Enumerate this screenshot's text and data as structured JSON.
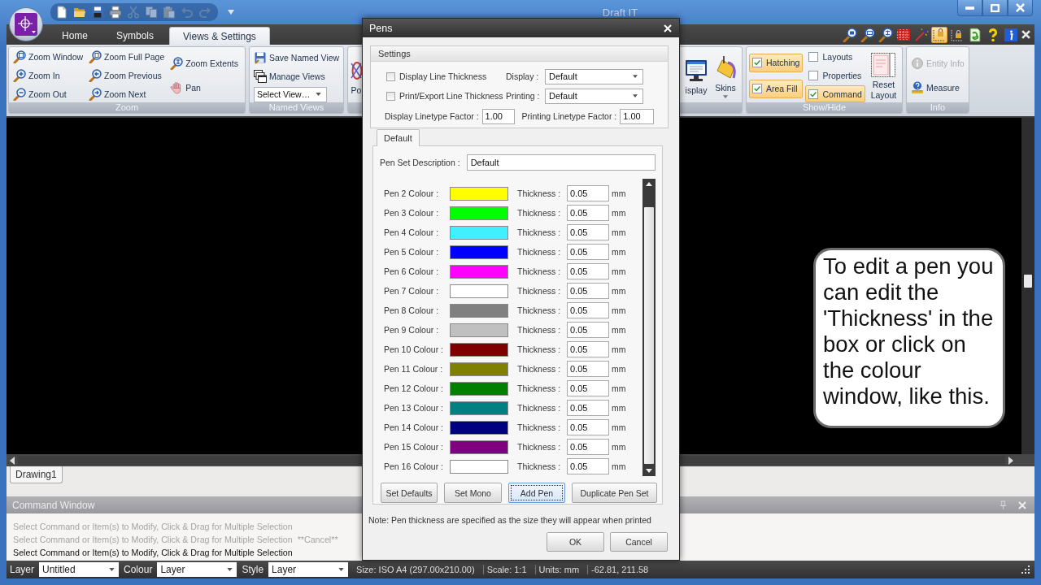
{
  "window": {
    "title": "Draft IT"
  },
  "quick_access": [
    {
      "disabled": false
    },
    {
      "disabled": false
    },
    {
      "disabled": false
    },
    {
      "disabled": false
    },
    {
      "disabled": true
    },
    {
      "disabled": true
    },
    {
      "disabled": true
    },
    {
      "disabled": true
    },
    {
      "disabled": true
    }
  ],
  "ribbon": {
    "tabs": [
      {
        "label": "Home",
        "selected": false
      },
      {
        "label": "Symbols",
        "selected": false
      },
      {
        "label": "Views & Settings",
        "selected": true
      }
    ],
    "tools": [
      {
        "on": false
      },
      {
        "on": false
      },
      {
        "on": false
      },
      {
        "on": false
      },
      {
        "on": false
      },
      {
        "on": true
      },
      {
        "on": false
      },
      {
        "on": false
      },
      {
        "on": false
      },
      {
        "on": false
      }
    ],
    "groups": [
      {
        "title": "Zoom",
        "columns": [
          [
            {
              "kind": "button",
              "label": "Zoom Window"
            },
            {
              "kind": "button",
              "label": "Zoom In"
            },
            {
              "kind": "button",
              "label": "Zoom Out"
            }
          ],
          [
            {
              "kind": "button",
              "label": "Zoom Full Page"
            },
            {
              "kind": "button",
              "label": "Zoom Previous"
            },
            {
              "kind": "button",
              "label": "Zoom Next"
            }
          ],
          [
            {
              "kind": "button",
              "label": "Zoom Extents"
            },
            {
              "kind": "button",
              "label": "Pan"
            }
          ]
        ]
      },
      {
        "title": "Named Views",
        "columns": [
          [
            {
              "kind": "button",
              "label": "Save Named View"
            },
            {
              "kind": "button",
              "label": "Manage Views"
            },
            {
              "kind": "dropdown",
              "label": "Select View…"
            }
          ]
        ]
      },
      {
        "columns": [
          [
            {
              "kind": "large",
              "label": "Po"
            }
          ],
          [
            {
              "kind": "large",
              "label": "isplay"
            }
          ],
          [
            {
              "kind": "large",
              "label": "Skins",
              "menu": true
            }
          ]
        ]
      },
      {
        "title": "Show/Hide",
        "columns": [
          [
            {
              "kind": "checkbox",
              "label": "Hatching",
              "checked": true
            },
            {
              "kind": "checkbox",
              "label": "Area Fill",
              "checked": true
            }
          ],
          [
            {
              "kind": "checkbox",
              "label": "Layouts",
              "checked": false
            },
            {
              "kind": "checkbox",
              "label": "Properties",
              "checked": false
            },
            {
              "kind": "checkbox",
              "label": "Command",
              "checked": true
            }
          ],
          [
            {
              "kind": "large",
              "label": "Reset Layout"
            }
          ]
        ]
      },
      {
        "title": "Info",
        "columns": [
          [
            {
              "kind": "button",
              "label": "Entity Info",
              "disabled": true
            },
            {
              "kind": "button",
              "label": "Measure",
              "disabled": false
            }
          ]
        ]
      }
    ]
  },
  "drawing_tabs": [
    {
      "label": "Drawing1",
      "selected": true
    }
  ],
  "command_window": {
    "title": "Command Window",
    "lines": [
      {
        "text": "Select Command or Item(s) to Modify, Click & Drag for Multiple Selection",
        "current": false
      },
      {
        "text": "Select Command or Item(s) to Modify, Click & Drag for Multiple Selection  **Cancel**",
        "current": false
      },
      {
        "text": "Select Command or Item(s) to Modify, Click & Drag for Multiple Selection",
        "current": true
      }
    ]
  },
  "status_bar": {
    "fields": [
      {
        "label": "Layer",
        "value": "Untitled"
      },
      {
        "label": "Colour",
        "value": "Layer"
      },
      {
        "label": "Style",
        "value": "Layer"
      }
    ],
    "info": [
      "Size: ISO A4 (297.00x210.00)",
      "Scale: 1:1",
      "Units: mm",
      "-62.81, 211.58"
    ]
  },
  "dialog": {
    "title": "Pens",
    "settings": {
      "title": "Settings",
      "checkboxes": [
        {
          "label": "Display Line Thickness",
          "checked": false
        },
        {
          "label": "Print/Export Line Thickness",
          "checked": false
        }
      ],
      "dropdowns": [
        {
          "label": "Display :",
          "value": "Default"
        },
        {
          "label": "Printing :",
          "value": "Default"
        }
      ],
      "factors": [
        {
          "label": "Display Linetype Factor :",
          "value": "1.00"
        },
        {
          "label": "Printing Linetype Factor :",
          "value": "1.00"
        }
      ]
    },
    "pen_set_tabs": [
      {
        "label": "Default",
        "selected": true
      }
    ],
    "pen_set": {
      "description_label": "Pen Set Description :",
      "description": "Default",
      "pens": [
        {
          "label": "Pen 2 Colour :",
          "color": "#ffff00",
          "thickness_label": "Thickness :",
          "thickness": "0.05",
          "unit": "mm"
        },
        {
          "label": "Pen 3 Colour :",
          "color": "#00ff00",
          "thickness_label": "Thickness :",
          "thickness": "0.05",
          "unit": "mm"
        },
        {
          "label": "Pen 4 Colour :",
          "color": "#40f0ff",
          "thickness_label": "Thickness :",
          "thickness": "0.05",
          "unit": "mm"
        },
        {
          "label": "Pen 5 Colour :",
          "color": "#0000ff",
          "thickness_label": "Thickness :",
          "thickness": "0.05",
          "unit": "mm"
        },
        {
          "label": "Pen 6 Colour :",
          "color": "#ff00ff",
          "thickness_label": "Thickness :",
          "thickness": "0.05",
          "unit": "mm"
        },
        {
          "label": "Pen 7 Colour :",
          "color": "#ffffff",
          "thickness_label": "Thickness :",
          "thickness": "0.05",
          "unit": "mm"
        },
        {
          "label": "Pen 8 Colour :",
          "color": "#808080",
          "thickness_label": "Thickness :",
          "thickness": "0.05",
          "unit": "mm"
        },
        {
          "label": "Pen 9 Colour :",
          "color": "#c0c0c0",
          "thickness_label": "Thickness :",
          "thickness": "0.05",
          "unit": "mm"
        },
        {
          "label": "Pen 10 Colour :",
          "color": "#800000",
          "thickness_label": "Thickness :",
          "thickness": "0.05",
          "unit": "mm"
        },
        {
          "label": "Pen 11 Colour :",
          "color": "#808000",
          "thickness_label": "Thickness :",
          "thickness": "0.05",
          "unit": "mm"
        },
        {
          "label": "Pen 12 Colour :",
          "color": "#008000",
          "thickness_label": "Thickness :",
          "thickness": "0.05",
          "unit": "mm"
        },
        {
          "label": "Pen 13 Colour :",
          "color": "#008080",
          "thickness_label": "Thickness :",
          "thickness": "0.05",
          "unit": "mm"
        },
        {
          "label": "Pen 14 Colour :",
          "color": "#000080",
          "thickness_label": "Thickness :",
          "thickness": "0.05",
          "unit": "mm"
        },
        {
          "label": "Pen 15 Colour :",
          "color": "#800080",
          "thickness_label": "Thickness :",
          "thickness": "0.05",
          "unit": "mm"
        },
        {
          "label": "Pen 16 Colour :",
          "color": "#ffffff",
          "thickness_label": "Thickness :",
          "thickness": "0.05",
          "unit": "mm"
        }
      ],
      "buttons": [
        {
          "label": "Set Defaults",
          "focused": false
        },
        {
          "label": "Set Mono",
          "focused": false
        },
        {
          "label": "Add Pen",
          "focused": true
        },
        {
          "label": "Duplicate Pen Set",
          "focused": false
        }
      ]
    },
    "note": "Note: Pen thickness are specified as the size they will appear when printed",
    "buttons": [
      {
        "label": "OK"
      },
      {
        "label": "Cancel"
      }
    ]
  },
  "callout": {
    "text": "To edit a pen you can edit the 'Thickness' in the box or click on the colour window, like this."
  }
}
